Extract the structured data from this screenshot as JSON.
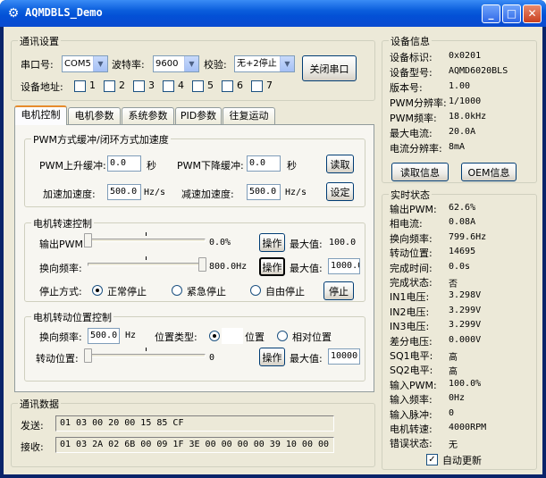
{
  "window": {
    "title": "AQMDBLS_Demo",
    "min": "_",
    "max": "□",
    "close": "✕"
  },
  "comm": {
    "group_title": "通讯设置",
    "port_label": "串口号:",
    "port_value": "COM5",
    "baud_label": "波特率:",
    "baud_value": "9600",
    "parity_label": "校验:",
    "parity_value": "无+2停止",
    "close_button": "关闭串口",
    "addr_label": "设备地址:",
    "addr_bits": [
      "1",
      "2",
      "3",
      "4",
      "5",
      "6",
      "7"
    ]
  },
  "tabs": [
    "电机控制",
    "电机参数",
    "系统参数",
    "PID参数",
    "往复运动"
  ],
  "pwm": {
    "group_title": "PWM方式缓冲/闭环方式加速度",
    "rise_label": "PWM上升缓冲:",
    "rise_value": "0.0",
    "rise_unit": "秒",
    "fall_label": "PWM下降缓冲:",
    "fall_value": "0.0",
    "fall_unit": "秒",
    "read_button": "读取",
    "acc_label": "加速加速度:",
    "acc_value": "500.0",
    "acc_unit": "Hz/s",
    "dec_label": "减速加速度:",
    "dec_value": "500.0",
    "dec_unit": "Hz/s",
    "set_button": "设定"
  },
  "speed": {
    "group_title": "电机转速控制",
    "out_label": "输出PWM:",
    "out_pct": 0,
    "out_value": "0.0%",
    "out_button": "操作",
    "out_max_label": "最大值:",
    "out_max_value": "100.0",
    "freq_label": "换向频率:",
    "freq_pct": 100,
    "freq_value": "800.0Hz",
    "freq_button": "操作",
    "freq_max_label": "最大值:",
    "freq_max_value": "1000.0",
    "stop_label": "停止方式:",
    "stop_normal": "正常停止",
    "stop_emergency": "紧急停止",
    "stop_free": "自由停止",
    "stop_button": "停止"
  },
  "position": {
    "group_title": "电机转动位置控制",
    "freq_label": "换向频率:",
    "freq_value": "500.0",
    "freq_unit": "Hz",
    "type_label": "位置类型:",
    "type_abs_value": "",
    "type_abs": "位置",
    "type_rel": "相对位置",
    "pos_label": "转动位置:",
    "pos_pct": 0,
    "pos_value": "0",
    "pos_button": "操作",
    "pos_max_label": "最大值:",
    "pos_max_value": "10000"
  },
  "data": {
    "group_title": "通讯数据",
    "send_label": "发送:",
    "send_value": "01 03 00 20 00 15 85 CF",
    "recv_label": "接收:",
    "recv_value": "01 03 2A 02 6B 00 09 1F 3E 00 00 00 00 39 10 00 00"
  },
  "device": {
    "group_title": "设备信息",
    "rows": [
      {
        "label": "设备标识:",
        "value": "0x0201"
      },
      {
        "label": "设备型号:",
        "value": "AQMD6020BLS"
      },
      {
        "label": "版本号:",
        "value": "1.00"
      },
      {
        "label": "PWM分辨率:",
        "value": "1/1000"
      },
      {
        "label": "PWM频率:",
        "value": "18.0kHz"
      },
      {
        "label": "最大电流:",
        "value": "20.0A"
      },
      {
        "label": "电流分辨率:",
        "value": "8mA"
      }
    ],
    "read_button": "读取信息",
    "oem_button": "OEM信息"
  },
  "realtime": {
    "group_title": "实时状态",
    "rows": [
      {
        "label": "输出PWM:",
        "value": "62.6%"
      },
      {
        "label": "相电流:",
        "value": "0.08A"
      },
      {
        "label": "换向频率:",
        "value": "799.6Hz"
      },
      {
        "label": "转动位置:",
        "value": "14695"
      },
      {
        "label": "完成时间:",
        "value": "0.0s"
      },
      {
        "label": "完成状态:",
        "value": "否"
      },
      {
        "label": "IN1电压:",
        "value": "3.298V"
      },
      {
        "label": "IN2电压:",
        "value": "3.299V"
      },
      {
        "label": "IN3电压:",
        "value": "3.299V"
      },
      {
        "label": "差分电压:",
        "value": "0.000V"
      },
      {
        "label": "SQ1电平:",
        "value": "高"
      },
      {
        "label": "SQ2电平:",
        "value": "高"
      },
      {
        "label": "输入PWM:",
        "value": "100.0%"
      },
      {
        "label": "输入频率:",
        "value": "0Hz"
      },
      {
        "label": "输入脉冲:",
        "value": "0"
      },
      {
        "label": "电机转速:",
        "value": "4000RPM"
      },
      {
        "label": "错误状态:",
        "value": "无"
      }
    ],
    "auto_update": "自动更新",
    "auto_update_check": "✓"
  }
}
